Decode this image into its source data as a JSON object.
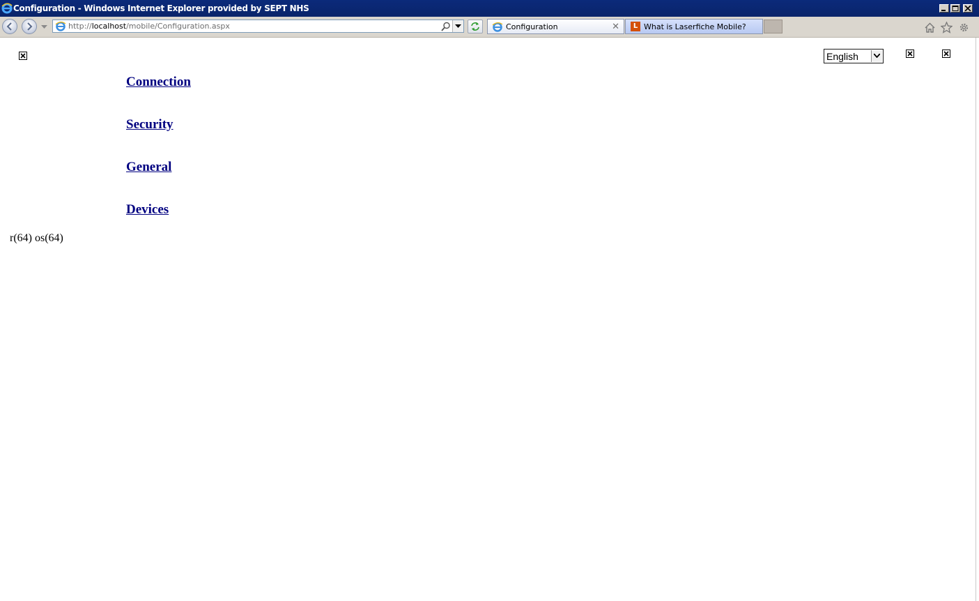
{
  "window": {
    "title": "Configuration - Windows Internet Explorer provided by SEPT NHS"
  },
  "address_bar": {
    "url_prefix": "http://",
    "url_host": "localhost",
    "url_path": "/mobile/Configuration.aspx"
  },
  "tabs": [
    {
      "label": "Configuration",
      "active": true
    },
    {
      "label": "What is Laserfiche Mobile?",
      "active": false,
      "icon_letter": "L"
    }
  ],
  "page": {
    "language_select": {
      "value": "English"
    },
    "links": [
      "Connection",
      "Security",
      "General",
      "Devices"
    ],
    "status_text": "r(64) os(64)"
  },
  "colors": {
    "title_bar": "#0a246a",
    "link": "#000080",
    "laserfiche_brand": "#d4500a"
  },
  "icons": [
    "ie-logo-icon",
    "back-icon",
    "forward-icon",
    "search-icon",
    "refresh-icon",
    "home-icon",
    "favorites-star-icon",
    "tools-gear-icon",
    "broken-image-icon"
  ]
}
